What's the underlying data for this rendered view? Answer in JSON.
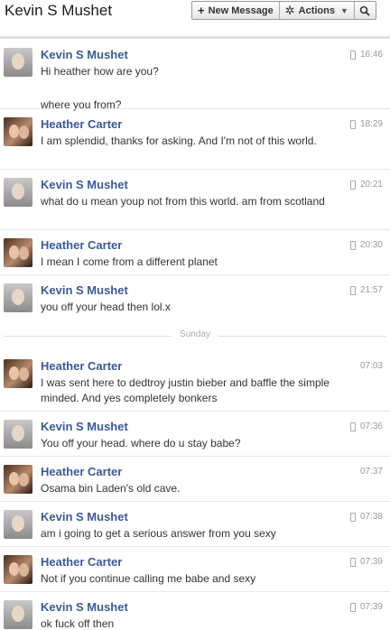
{
  "header": {
    "title": "Kevin S Mushet",
    "new_message_label": "New Message",
    "actions_label": "Actions",
    "new_message_icon": "plus-icon",
    "actions_icon": "gear-icon",
    "search_icon": "search-icon"
  },
  "day_separator": "Sunday",
  "messages": [
    {
      "sender": "Kevin S Mushet",
      "time": "16:46",
      "mobile": true,
      "lines": [
        "Hi heather how are you?",
        "where you from?"
      ]
    },
    {
      "sender": "Heather Carter",
      "time": "18:29",
      "mobile": true,
      "lines": [
        "I am splendid, thanks for asking. And I'm not of this world."
      ]
    },
    {
      "sender": "Kevin S Mushet",
      "time": "20:21",
      "mobile": true,
      "lines": [
        "what do u mean youp not from this world. am from scotland"
      ]
    },
    {
      "sender": "Heather Carter",
      "time": "20:30",
      "mobile": true,
      "lines": [
        "I mean I come from a different planet"
      ]
    },
    {
      "sender": "Kevin S Mushet",
      "time": "21:57",
      "mobile": true,
      "lines": [
        "you off your head then lol.x"
      ]
    },
    {
      "sender": "Heather Carter",
      "time": "07:03",
      "mobile": false,
      "lines": [
        "I was sent here to dedtroy justin bieber and baffle the simple minded. And yes completely bonkers"
      ]
    },
    {
      "sender": "Kevin S Mushet",
      "time": "07:36",
      "mobile": true,
      "lines": [
        "You off your head. where do u stay babe?"
      ]
    },
    {
      "sender": "Heather Carter",
      "time": "07:37",
      "mobile": false,
      "lines": [
        "Osama bin Laden's old cave."
      ]
    },
    {
      "sender": "Kevin S Mushet",
      "time": "07:38",
      "mobile": true,
      "lines": [
        "am i going to get a serious answer from you sexy"
      ]
    },
    {
      "sender": "Heather Carter",
      "time": "07:39",
      "mobile": true,
      "lines": [
        "Not if you continue calling me babe and sexy"
      ]
    },
    {
      "sender": "Kevin S Mushet",
      "time": "07:39",
      "mobile": true,
      "lines": [
        "ok fuck off then"
      ]
    }
  ]
}
